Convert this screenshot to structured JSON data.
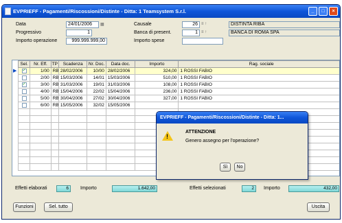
{
  "window": {
    "title": "EVPRIEFF - Pagamenti/Riscossioni/Distinte - Ditta: 1 Teamsystem S.r.l."
  },
  "form": {
    "data_label": "Data",
    "data_value": "24/01/2006",
    "progressivo_label": "Progressivo",
    "progressivo_value": "1",
    "importo_op_label": "Importo operazione",
    "importo_op_value": "999.999.999,00",
    "causale_label": "Causale",
    "causale_value": "26",
    "causale_desc": "DISTINTA RIBA",
    "banca_label": "Banca di present.",
    "banca_value": "1",
    "banca_desc": "BANCA DI ROMA SPA",
    "spese_label": "Importo spese",
    "spese_value": ""
  },
  "table": {
    "headers": [
      "Sel.",
      "Nr. Eff.",
      "TP",
      "Scadenza",
      "Nr. Doc.",
      "Data doc.",
      "Importo",
      "Rag. sociale"
    ],
    "rows": [
      {
        "sel": true,
        "nr": "1/00",
        "tp": "RB",
        "scad": "28/02/2006",
        "doc": "10/00",
        "data": "28/02/2006",
        "imp": "324,00",
        "rag": "1 ROSSI FABIO"
      },
      {
        "sel": false,
        "nr": "2/00",
        "tp": "RB",
        "scad": "15/03/2006",
        "doc": "14/01",
        "data": "15/03/2006",
        "imp": "510,00",
        "rag": "1 ROSSI FABIO"
      },
      {
        "sel": true,
        "nr": "3/00",
        "tp": "RB",
        "scad": "31/03/2006",
        "doc": "19/01",
        "data": "31/03/2006",
        "imp": "108,00",
        "rag": "1 ROSSI FABIO"
      },
      {
        "sel": false,
        "nr": "4/00",
        "tp": "RB",
        "scad": "15/04/2006",
        "doc": "22/02",
        "data": "15/04/2006",
        "imp": "236,00",
        "rag": "1 ROSSI FABIO"
      },
      {
        "sel": false,
        "nr": "5/00",
        "tp": "RB",
        "scad": "30/04/2006",
        "doc": "27/02",
        "data": "30/04/2006",
        "imp": "327,00",
        "rag": "1 ROSSI FABIO"
      },
      {
        "sel": false,
        "nr": "6/00",
        "tp": "RB",
        "scad": "15/05/2006",
        "doc": "32/02",
        "data": "15/05/2006",
        "imp": "",
        "rag": ""
      }
    ]
  },
  "summary": {
    "elaborati_label": "Effetti elaborati",
    "elaborati_value": "6",
    "importo1_label": "Importo",
    "importo1_value": "1.642,00",
    "selezionati_label": "Effetti selezionati",
    "selezionati_value": "2",
    "importo2_label": "Importo",
    "importo2_value": "432,00"
  },
  "buttons": {
    "funzioni": "Funzioni",
    "sel_tutto": "Sel. tutto",
    "uscita": "Uscita"
  },
  "dialog": {
    "title": "EVPRIEFF - Pagamenti/Riscossioni/Distinte - Ditta: 1...",
    "heading": "ATTENZIONE",
    "message": "Genero assegno per l'operazione?",
    "yes": "Sì",
    "no": "No"
  },
  "colors": {
    "titlebar": "#0f56d9",
    "selected_row": "#ffffcc",
    "summary_bar": "#7fd7d7"
  },
  "icons": [
    "app-icon",
    "calendar-icon",
    "lookup-icon",
    "warning-icon",
    "checkbox-checked-icon"
  ]
}
